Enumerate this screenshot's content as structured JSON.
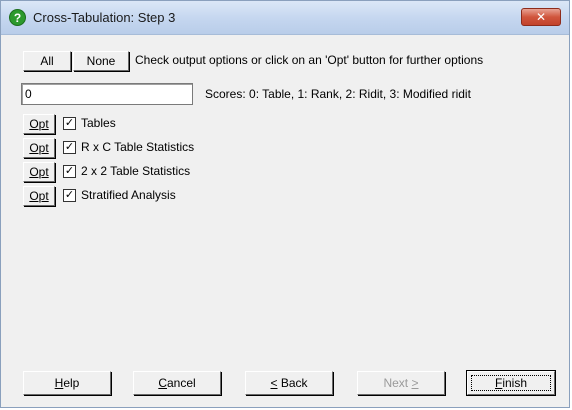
{
  "window": {
    "title": "Cross-Tabulation: Step 3",
    "close_glyph": "✕"
  },
  "top_row": {
    "all_label": "All",
    "none_label": "None",
    "instruction": "Check output options or click on an 'Opt' button for further options"
  },
  "scores": {
    "value": "0",
    "label": "Scores: 0: Table, 1: Rank, 2: Ridit, 3: Modified ridit"
  },
  "options": [
    {
      "opt_label": "Opt",
      "label": "Tables",
      "checked": true
    },
    {
      "opt_label": "Opt",
      "label": "R x C Table Statistics",
      "checked": true
    },
    {
      "opt_label": "Opt",
      "label": "2 x 2 Table Statistics",
      "checked": true
    },
    {
      "opt_label": "Opt",
      "label": "Stratified Analysis",
      "checked": true
    }
  ],
  "footer": {
    "help": {
      "mnemonic": "H",
      "rest": "elp"
    },
    "cancel": {
      "mnemonic": "C",
      "rest": "ancel"
    },
    "back": {
      "mnemonic": "<",
      "rest": " Back"
    },
    "next": {
      "label": "Next",
      "mnemonic": ">"
    },
    "finish": {
      "mnemonic": "F",
      "rest": "inish"
    }
  },
  "icons": {
    "title": "help-question-icon",
    "close": "close-icon"
  },
  "colors": {
    "title_icon": "#2d9a2d",
    "close_button": "#c2422b",
    "dialog_bg": "#f0f0f0"
  }
}
